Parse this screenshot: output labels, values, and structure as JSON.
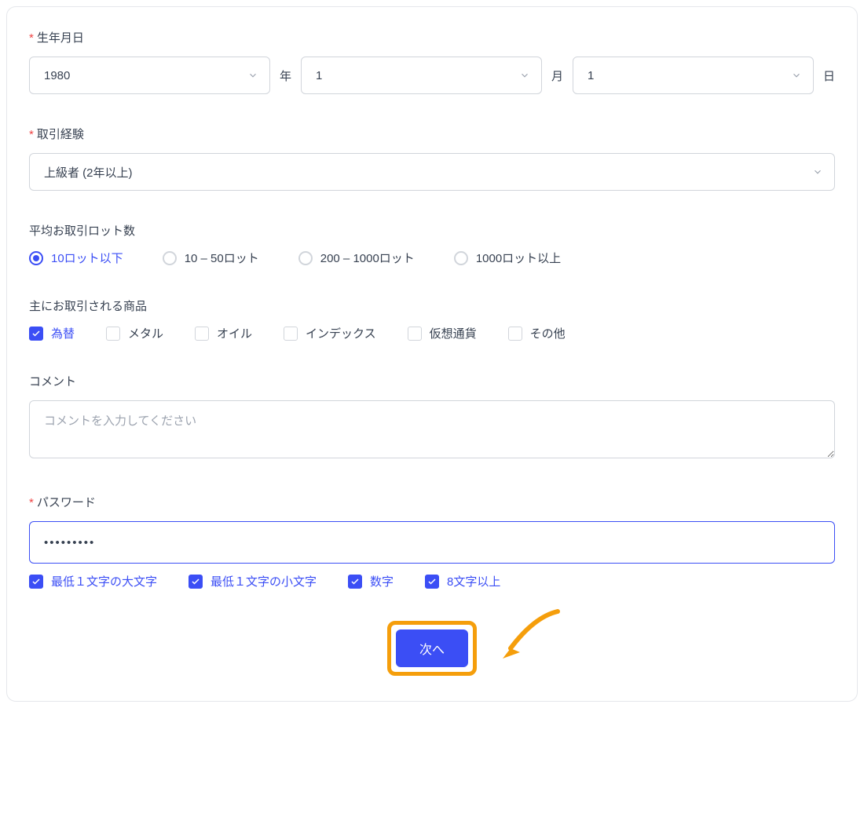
{
  "birthdate": {
    "label": "生年月日",
    "year": "1980",
    "year_unit": "年",
    "month": "1",
    "month_unit": "月",
    "day": "1",
    "day_unit": "日"
  },
  "experience": {
    "label": "取引経験",
    "value": "上級者 (2年以上)"
  },
  "avg_lots": {
    "label": "平均お取引ロット数",
    "options": [
      {
        "label": "10ロット以下",
        "selected": true
      },
      {
        "label": "10 – 50ロット",
        "selected": false
      },
      {
        "label": "200 – 1000ロット",
        "selected": false
      },
      {
        "label": "1000ロット以上",
        "selected": false
      }
    ]
  },
  "products": {
    "label": "主にお取引される商品",
    "options": [
      {
        "label": "為替",
        "checked": true
      },
      {
        "label": "メタル",
        "checked": false
      },
      {
        "label": "オイル",
        "checked": false
      },
      {
        "label": "インデックス",
        "checked": false
      },
      {
        "label": "仮想通貨",
        "checked": false
      },
      {
        "label": "その他",
        "checked": false
      }
    ]
  },
  "comment": {
    "label": "コメント",
    "placeholder": "コメントを入力してください"
  },
  "password": {
    "label": "パスワード",
    "value": "•••••••••",
    "validations": [
      {
        "label": "最低１文字の大文字",
        "passed": true
      },
      {
        "label": "最低１文字の小文字",
        "passed": true
      },
      {
        "label": "数字",
        "passed": true
      },
      {
        "label": "8文字以上",
        "passed": true
      }
    ]
  },
  "submit": {
    "label": "次へ"
  }
}
